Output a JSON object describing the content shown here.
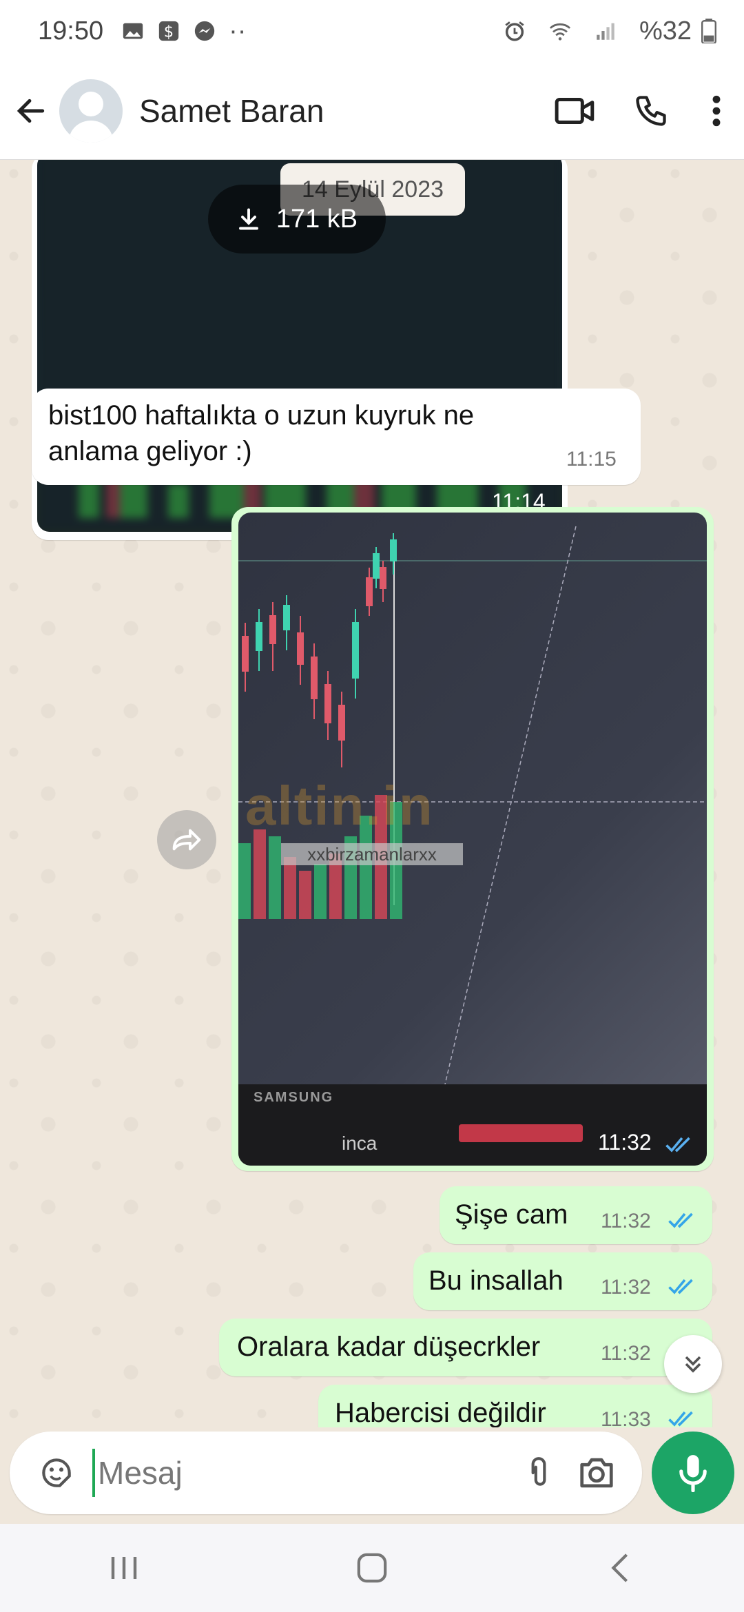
{
  "status_bar": {
    "time": "19:50",
    "battery": "%32",
    "icons": [
      "image-icon",
      "dollar-icon",
      "messenger-icon",
      "more-dots-icon",
      "alarm-icon",
      "wifi-icon",
      "signal-icon",
      "battery-icon"
    ]
  },
  "header": {
    "contact_name": "Samet Baran",
    "icons": [
      "back-arrow-icon",
      "video-call-icon",
      "phone-icon",
      "more-vert-icon"
    ]
  },
  "chat": {
    "date_chip": "14 Eylül 2023",
    "messages": [
      {
        "type": "image",
        "direction": "in",
        "download_size": "171 kB",
        "time": "11:14"
      },
      {
        "type": "text",
        "direction": "in",
        "text_line1": "bist100 haftalıkta o uzun kuyruk ne",
        "text_line2": "anlama geliyor :)",
        "time": "11:15"
      },
      {
        "type": "image",
        "direction": "out",
        "time": "11:32",
        "watermark_label": "xxbirzamanlarxx",
        "brand_watermark": "altin.in",
        "monitor_brand": "SAMSUNG",
        "keyboard_brand": "inca",
        "status": "read"
      },
      {
        "type": "text",
        "direction": "out",
        "text": "Şişe cam",
        "time": "11:32",
        "status": "read"
      },
      {
        "type": "text",
        "direction": "out",
        "text": "Bu insallah",
        "time": "11:32",
        "status": "read"
      },
      {
        "type": "text",
        "direction": "out",
        "text": "Oralara kadar düşecrkler",
        "time": "11:32",
        "status": "read"
      },
      {
        "type": "text",
        "direction": "out",
        "text": "Habercisi değildir",
        "time": "11:33",
        "status": "read"
      }
    ]
  },
  "input": {
    "placeholder": "Mesaj"
  },
  "colors": {
    "accent": "#1ca566",
    "outgoing_bubble": "#d8fdd2",
    "incoming_bubble": "#ffffff",
    "read_ticks": "#34a5e8",
    "wallpaper": "#efe7dc"
  }
}
